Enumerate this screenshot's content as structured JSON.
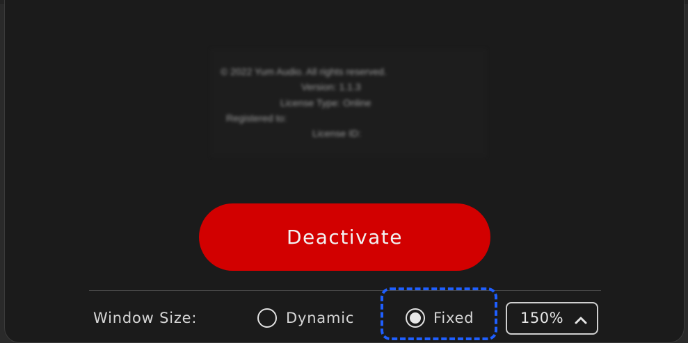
{
  "about": {
    "copyright": "© 2022 Yum Audio. All rights reserved.",
    "version": "Version: 1.1.3",
    "license_type": "License Type: Online",
    "registered_to": "Registered to:",
    "license_id": "License ID:"
  },
  "deactivate_label": "Deactivate",
  "window_size": {
    "label": "Window Size:",
    "options": [
      {
        "label": "Dynamic",
        "selected": false
      },
      {
        "label": "Fixed",
        "selected": true
      }
    ],
    "zoom_value": "150%"
  },
  "colors": {
    "accent": "#d20000",
    "focus": "#1f5fff",
    "background": "#1b1b1b"
  },
  "icons": {
    "zoom_stepper": "chevron-up-icon"
  }
}
